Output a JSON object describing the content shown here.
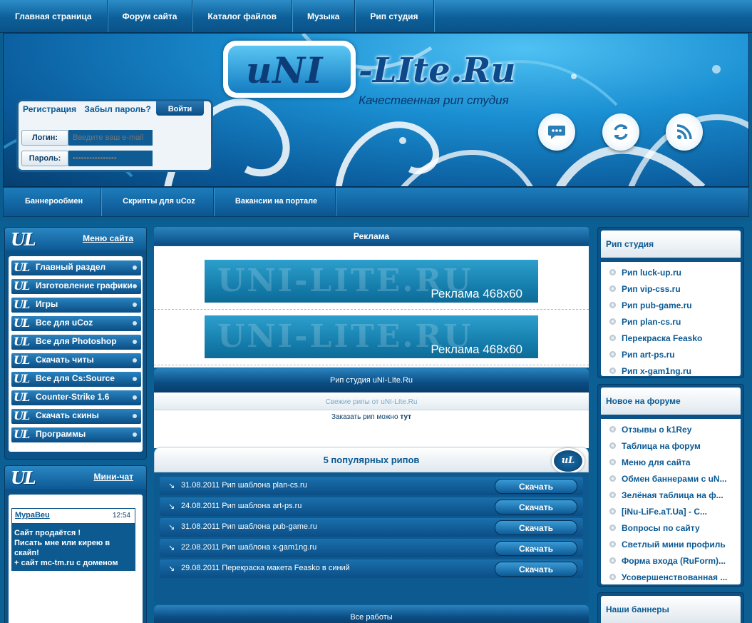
{
  "top_nav": [
    "Главная страница",
    "Форум сайта",
    "Каталог файлов",
    "Музыка",
    "Рип студия"
  ],
  "logo": {
    "part1": "uNI",
    "part2": "-LIte.Ru",
    "tagline": "Качественная рип студия"
  },
  "login": {
    "register": "Регистрация",
    "forgot": "Забыл пароль?",
    "submit": "Войти",
    "login_label": "Логин:",
    "login_placeholder": "Введите ваш e-mail",
    "password_label": "Пароль:",
    "password_placeholder": "••••••••••••••••"
  },
  "sub_nav": [
    "Баннерообмен",
    "Скрипты для uCoz",
    "Вакансии на портале"
  ],
  "site_menu": {
    "logo": "UL",
    "title": "Меню сайта",
    "items": [
      "Главный раздел",
      "Изготовление графики",
      "Игры",
      "Все для uCoz",
      "Все для Photoshop",
      "Скачать читы",
      "Все для Cs:Source",
      "Counter-Strike 1.6",
      "Скачать скины",
      "Программы"
    ]
  },
  "mini_chat": {
    "logo": "UL",
    "title": "Мини-чат",
    "message": {
      "user": "МураВеu",
      "time": "12:54",
      "text1": "Сайт продаётся !",
      "text2": "Писать мне или кирею в скайп!",
      "text3": "+ сайт mc-tm.ru с доменом"
    }
  },
  "ads": {
    "title": "Реклама",
    "banner_watermark": "UNI-LITE.RU",
    "banner_text": "Реклама 468x60"
  },
  "rip_studio": {
    "title": "Рип студия uNI-LIte.Ru",
    "fresh": "Свежие рипы от uNI-LIte.Ru",
    "order_text": "Заказать рип можно",
    "order_link": "тут"
  },
  "popular": {
    "title": "5 популярных рипов",
    "badge": "uL",
    "download_label": "Скачать",
    "items": [
      "31.08.2011 Рип шаблона plan-cs.ru",
      "24.08.2011 Рип шаблона art-ps.ru",
      "31.08.2011 Рип шаблона pub-game.ru",
      "22.08.2011 Рип шаблона x-gam1ng.ru",
      "29.08.2011 Перекраска макета Feasko в синий"
    ]
  },
  "all_works": "Все работы",
  "right_rip": {
    "title": "Рип студия",
    "items": [
      "Рип luck-up.ru",
      "Рип vip-css.ru",
      "Рип pub-game.ru",
      "Рип plan-cs.ru",
      "Перекраска Feasko",
      "Рип art-ps.ru",
      "Рип x-gam1ng.ru"
    ]
  },
  "right_forum": {
    "title": "Новое на форуме",
    "items": [
      "Отзывы о k1Rey",
      "Таблица на форум",
      "Меню для сайта",
      "Обмен баннерами с uN...",
      "Зелёная таблица на ф...",
      "[iNu-LiFe.aT.Ua] - С...",
      "Вопросы по сайту",
      "Светлый мини профиль",
      "Форма входа (RuForm)...",
      "Усовершенствованная ..."
    ]
  },
  "right_banners": {
    "title": "Наши баннеры"
  }
}
